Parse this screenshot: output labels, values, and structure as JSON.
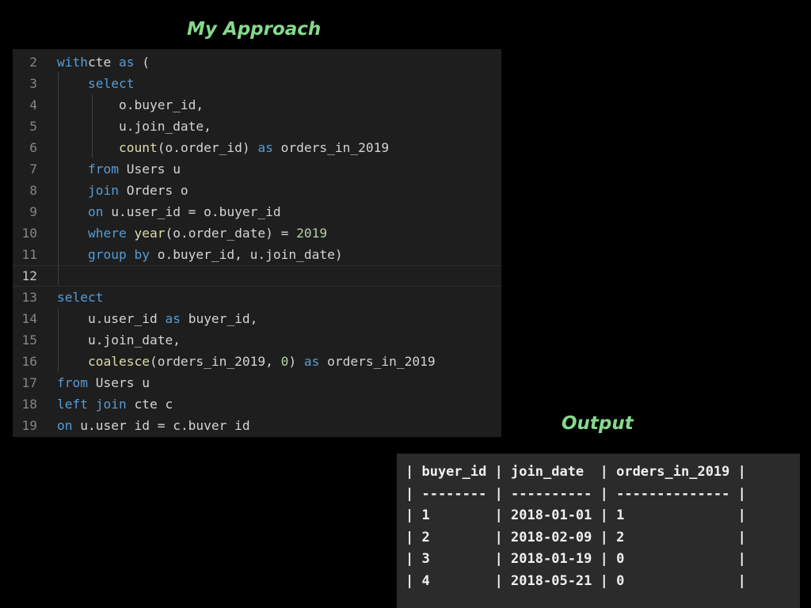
{
  "headings": {
    "approach": "My Approach",
    "output": "Output"
  },
  "code_lines": [
    {
      "ln": "2",
      "indent": 0,
      "tokens": [
        [
          "kw",
          "with"
        ],
        [
          "",
          "cte "
        ],
        [
          "kw",
          "as"
        ],
        [
          "",
          " ("
        ]
      ]
    },
    {
      "ln": "3",
      "indent": 1,
      "tokens": [
        [
          "",
          "    "
        ],
        [
          "kw",
          "select"
        ]
      ]
    },
    {
      "ln": "4",
      "indent": 2,
      "tokens": [
        [
          "",
          "        o.buyer_id,"
        ]
      ]
    },
    {
      "ln": "5",
      "indent": 2,
      "tokens": [
        [
          "",
          "        u.join_date,"
        ]
      ]
    },
    {
      "ln": "6",
      "indent": 2,
      "tokens": [
        [
          "",
          "        "
        ],
        [
          "fn",
          "count"
        ],
        [
          "",
          "(o.order_id) "
        ],
        [
          "kw",
          "as"
        ],
        [
          "",
          " orders_in_2019"
        ]
      ]
    },
    {
      "ln": "7",
      "indent": 1,
      "tokens": [
        [
          "",
          "    "
        ],
        [
          "kw",
          "from"
        ],
        [
          "",
          " Users u"
        ]
      ]
    },
    {
      "ln": "8",
      "indent": 1,
      "tokens": [
        [
          "",
          "    "
        ],
        [
          "kw",
          "join"
        ],
        [
          "",
          " Orders o"
        ]
      ]
    },
    {
      "ln": "9",
      "indent": 1,
      "tokens": [
        [
          "",
          "    "
        ],
        [
          "kw",
          "on"
        ],
        [
          "",
          " u.user_id = o.buyer_id"
        ]
      ]
    },
    {
      "ln": "10",
      "indent": 1,
      "tokens": [
        [
          "",
          "    "
        ],
        [
          "kw",
          "where"
        ],
        [
          "",
          " "
        ],
        [
          "fn",
          "year"
        ],
        [
          "",
          "(o.order_date) = "
        ],
        [
          "num",
          "2019"
        ]
      ]
    },
    {
      "ln": "11",
      "indent": 1,
      "tokens": [
        [
          "",
          "    "
        ],
        [
          "kw",
          "group by"
        ],
        [
          "",
          " o.buyer_id, u.join_date)"
        ]
      ]
    },
    {
      "ln": "12",
      "indent": 1,
      "current": true,
      "tokens": []
    },
    {
      "ln": "13",
      "indent": 0,
      "tokens": [
        [
          "kw",
          "select"
        ]
      ]
    },
    {
      "ln": "14",
      "indent": 1,
      "tokens": [
        [
          "",
          "    u.user_id "
        ],
        [
          "kw",
          "as"
        ],
        [
          "",
          " buyer_id,"
        ]
      ]
    },
    {
      "ln": "15",
      "indent": 1,
      "tokens": [
        [
          "",
          "    u.join_date,"
        ]
      ]
    },
    {
      "ln": "16",
      "indent": 1,
      "tokens": [
        [
          "",
          "    "
        ],
        [
          "fn",
          "coalesce"
        ],
        [
          "",
          "(orders_in_2019, "
        ],
        [
          "num",
          "0"
        ],
        [
          "",
          ") "
        ],
        [
          "kw",
          "as"
        ],
        [
          "",
          " orders_in_2019"
        ]
      ]
    },
    {
      "ln": "17",
      "indent": 0,
      "tokens": [
        [
          "kw",
          "from"
        ],
        [
          "",
          " Users u"
        ]
      ]
    },
    {
      "ln": "18",
      "indent": 0,
      "tokens": [
        [
          "kw",
          "left join"
        ],
        [
          "",
          " cte c"
        ]
      ]
    },
    {
      "ln": "19",
      "indent": 0,
      "tokens": [
        [
          "kw",
          "on"
        ],
        [
          "",
          " u.user id = c.buver id"
        ]
      ]
    }
  ],
  "output_table": {
    "columns": [
      "buyer_id",
      "join_date",
      "orders_in_2019"
    ],
    "widths": [
      8,
      10,
      14
    ],
    "rows": [
      [
        "1",
        "2018-01-01",
        "1"
      ],
      [
        "2",
        "2018-02-09",
        "2"
      ],
      [
        "3",
        "2018-01-19",
        "0"
      ],
      [
        "4",
        "2018-05-21",
        "0"
      ]
    ]
  },
  "colors": {
    "heading": "#86d98c",
    "keyword": "#569cd6",
    "function": "#dcdcaa",
    "number": "#b5cea8",
    "text": "#d4d4d4",
    "editor_bg": "#1e1e1e",
    "output_bg": "#2b2b2b"
  }
}
